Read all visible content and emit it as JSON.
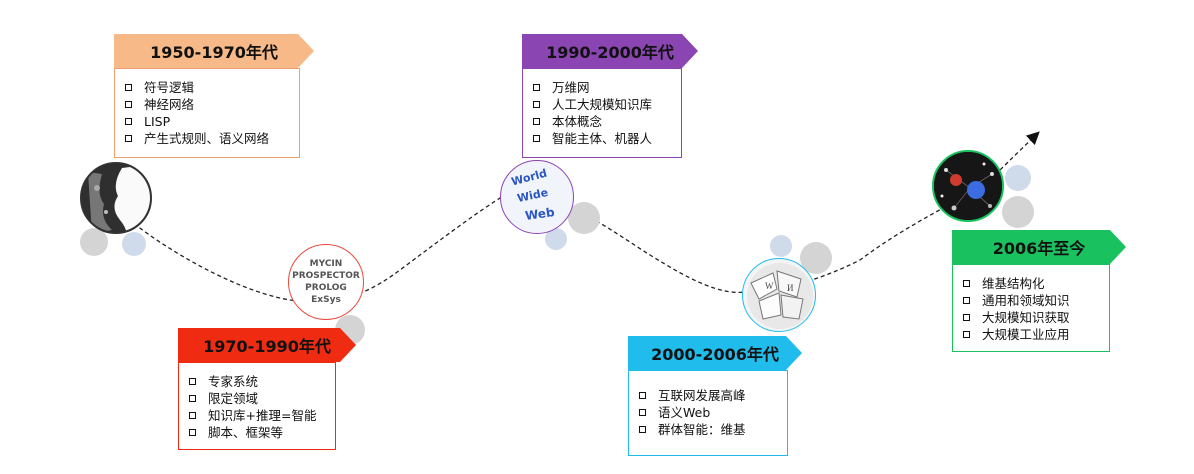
{
  "eras": [
    {
      "title": "1950-1970年代",
      "color": "#f7b987",
      "items": [
        "符号逻辑",
        "神经网络",
        "LISP",
        "产生式规则、语义网络"
      ]
    },
    {
      "title": "1970-1990年代",
      "color": "#ef2b12",
      "items": [
        "专家系统",
        "限定领域",
        "知识库+推理=智能",
        "脚本、框架等"
      ]
    },
    {
      "title": "1990-2000年代",
      "color": "#8b45b3",
      "items": [
        "万维网",
        "人工大规模知识库",
        "本体概念",
        "智能主体、机器人"
      ]
    },
    {
      "title": "2000-2006年代",
      "color": "#1fbcec",
      "items": [
        "互联网发展高峰",
        "语义Web",
        "群体智能：维基"
      ]
    },
    {
      "title": "2006年至今",
      "color": "#19c25f",
      "items": [
        "维基结构化",
        "通用和领域知识",
        "大规模知识获取",
        "大规模工业应用"
      ]
    }
  ],
  "mycin_circle": {
    "lines": [
      "MYCIN",
      "PROSPECTOR",
      "PROLOG",
      "ExSys"
    ]
  },
  "www_circle": {
    "lines": [
      "World",
      "Wide",
      "Web"
    ]
  },
  "colors": {
    "path": "#222222",
    "dot_gray": "#d4d4d4",
    "dot_blue": "#cfdbea"
  }
}
